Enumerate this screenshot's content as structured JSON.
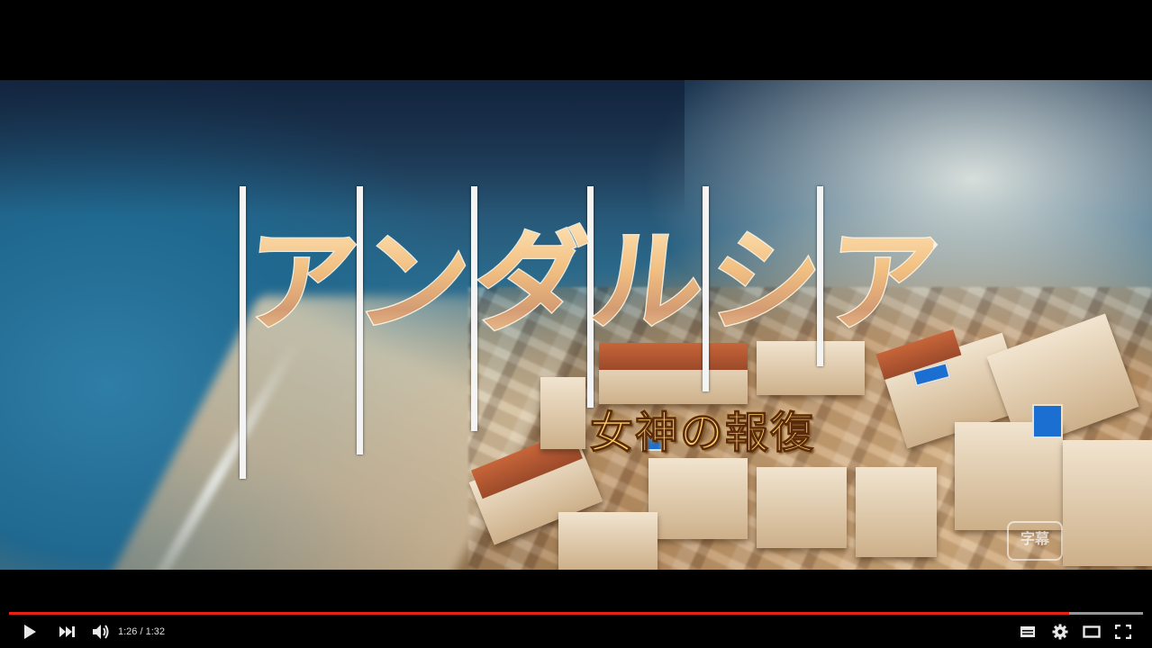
{
  "video": {
    "title_text": "アンダルシア",
    "subtitle_text": "女神の報復",
    "watermark_text": "字幕"
  },
  "controls": {
    "current_time": "1:26",
    "separator": " / ",
    "duration": "1:32",
    "progress_fraction": 0.935,
    "buffered_fraction": 1.0,
    "icons": [
      "play-icon",
      "next-icon",
      "volume-icon",
      "subtitles-icon",
      "settings-gear-icon",
      "theater-mode-icon",
      "fullscreen-icon"
    ]
  },
  "colors": {
    "progress_played": "#e62117",
    "title_gold": "#e9962f"
  }
}
